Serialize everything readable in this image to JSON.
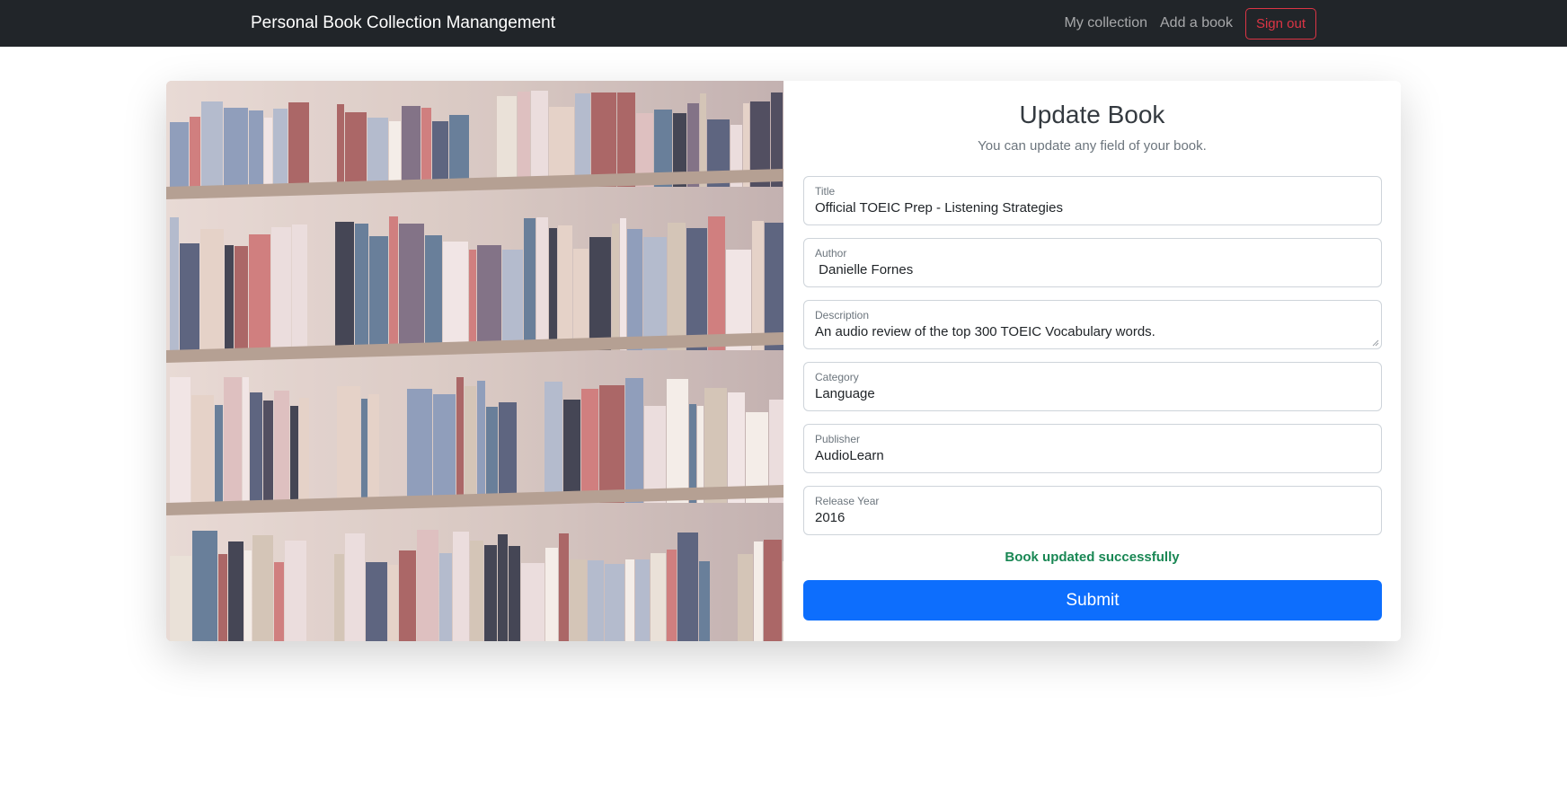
{
  "navbar": {
    "brand": "Personal Book Collection Manangement",
    "links": [
      {
        "label": "My collection"
      },
      {
        "label": "Add a book"
      }
    ],
    "signout_label": "Sign out"
  },
  "form": {
    "title": "Update Book",
    "subtitle": "You can update any field of your book.",
    "fields": {
      "title": {
        "label": "Title",
        "value": "Official TOEIC Prep - Listening Strategies"
      },
      "author": {
        "label": "Author",
        "value": " Danielle Fornes"
      },
      "description": {
        "label": "Description",
        "value": "An audio review of the top 300 TOEIC Vocabulary words."
      },
      "category": {
        "label": "Category",
        "value": "Language"
      },
      "publisher": {
        "label": "Publisher",
        "value": "AudioLearn"
      },
      "release_year": {
        "label": "Release Year",
        "value": "2016"
      }
    },
    "success_message": "Book updated successfully",
    "submit_label": "Submit"
  },
  "colors": {
    "navbar_bg": "#212529",
    "primary": "#0d6efd",
    "danger": "#dc3545",
    "success": "#198754"
  }
}
